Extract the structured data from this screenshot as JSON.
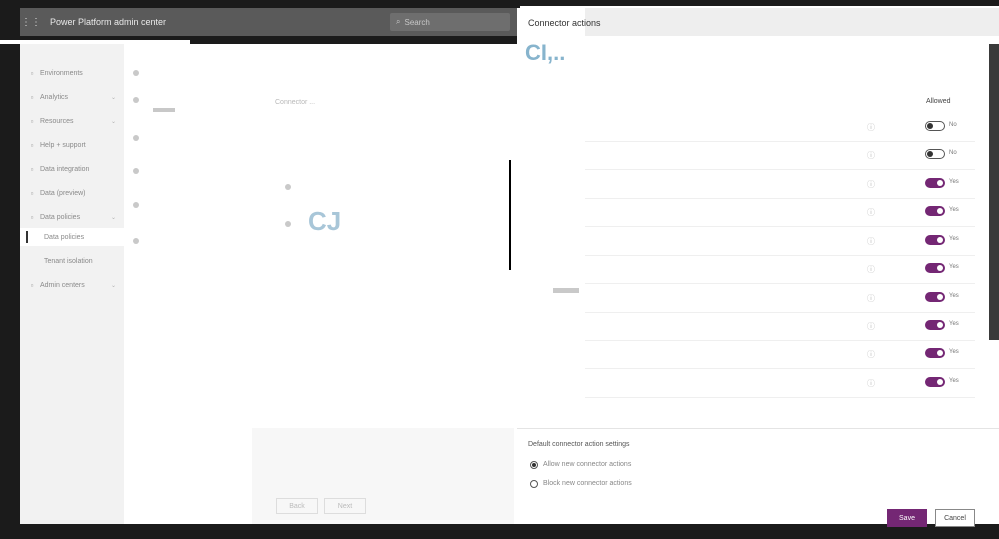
{
  "header": {
    "waffle_icon": "waffle-icon",
    "app_title": "Power Platform admin center",
    "search_placeholder": "Search"
  },
  "sidebar": {
    "items": [
      {
        "label": "Environments",
        "icon": "globe-icon"
      },
      {
        "label": "Analytics",
        "icon": "chart-icon",
        "chevron": "⌄"
      },
      {
        "label": "Resources",
        "icon": "chart-icon",
        "chevron": "⌄"
      },
      {
        "label": "Help + support",
        "icon": "bulb-icon"
      },
      {
        "label": "Data integration",
        "icon": "data-icon"
      },
      {
        "label": "Data (preview)",
        "icon": "data-icon"
      },
      {
        "label": "Data policies",
        "icon": "shield-icon",
        "chevron": "⌄"
      },
      {
        "label": "Data policies",
        "active": true
      },
      {
        "label": "Tenant isolation"
      },
      {
        "label": "Admin centers",
        "icon": "gear-icon",
        "chevron": "⌄"
      }
    ]
  },
  "main": {
    "blur_text": "Connector ...",
    "cj_text": "CJ",
    "ghost_buttons": [
      "Back",
      "Next"
    ]
  },
  "panel": {
    "title": "Connector actions",
    "subtitle": "CI,..",
    "allowed_header": "Allowed",
    "rows": [
      {
        "allowed": false,
        "label": "No"
      },
      {
        "allowed": false,
        "label": "No"
      },
      {
        "allowed": true,
        "label": "Yes"
      },
      {
        "allowed": true,
        "label": "Yes"
      },
      {
        "allowed": true,
        "label": "Yes"
      },
      {
        "allowed": true,
        "label": "Yes"
      },
      {
        "allowed": true,
        "label": "Yes"
      },
      {
        "allowed": true,
        "label": "Yes"
      },
      {
        "allowed": true,
        "label": "Yes"
      },
      {
        "allowed": true,
        "label": "Yes"
      }
    ],
    "info_icon": "ⓘ",
    "default_title": "Default connector action settings",
    "radio_options": [
      {
        "label": "Allow new connector actions",
        "selected": true
      },
      {
        "label": "Block new connector actions",
        "selected": false
      }
    ],
    "save_label": "Save",
    "cancel_label": "Cancel"
  },
  "colors": {
    "accent": "#742774",
    "topbar": "#5a5a5a"
  }
}
